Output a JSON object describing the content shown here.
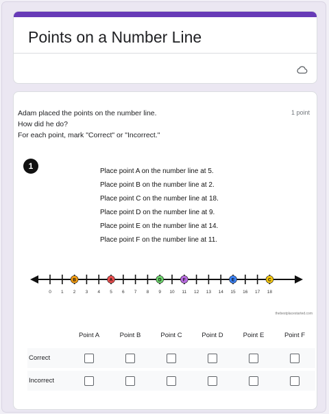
{
  "header": {
    "title": "Points on a Number Line",
    "accent_color": "#673ab7",
    "icon": "cloud-saved-icon"
  },
  "question": {
    "prompt_lines": [
      "Adam placed the points on the number line.",
      "How did he do?",
      "For each point, mark \"Correct\" or \"Incorrect.\""
    ],
    "points": "1 point",
    "image": {
      "badge": "1",
      "instructions": [
        "Place point A on the number line at 5.",
        "Place point B on the number line at 2.",
        "Place point C on the number line at 18.",
        "Place point D on the number line at 9.",
        "Place point E on the number line at 14.",
        "Place point F on the number line at 11."
      ],
      "number_line": {
        "ticks": [
          "0",
          "1",
          "2",
          "3",
          "4",
          "5",
          "6",
          "7",
          "8",
          "9",
          "10",
          "11",
          "12",
          "13",
          "14",
          "15",
          "16",
          "17",
          "18"
        ],
        "points": [
          {
            "label": "A",
            "value": 5,
            "color": "#e74c4c"
          },
          {
            "label": "B",
            "value": 2,
            "color": "#f39c12"
          },
          {
            "label": "C",
            "value": 18,
            "color": "#f1c40f"
          },
          {
            "label": "D",
            "value": 9,
            "color": "#6bd36b"
          },
          {
            "label": "E",
            "value": 15,
            "color": "#3b82f6"
          },
          {
            "label": "F",
            "value": 11,
            "color": "#b86be0"
          }
        ]
      },
      "credit": "thebestplacestarted.com"
    },
    "grid": {
      "columns": [
        "Point A",
        "Point B",
        "Point C",
        "Point D",
        "Point E",
        "Point F"
      ],
      "rows": [
        "Correct",
        "Incorrect"
      ]
    }
  }
}
